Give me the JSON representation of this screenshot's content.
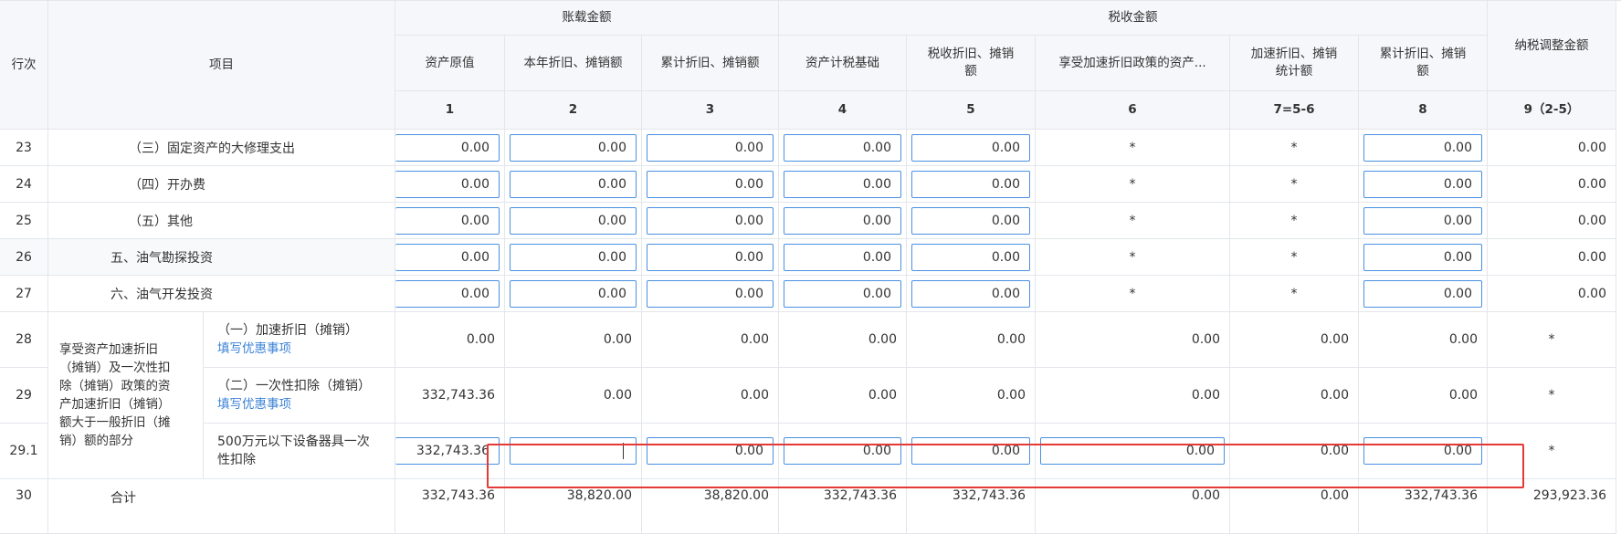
{
  "header": {
    "row_no": "行次",
    "item": "项目",
    "group_book": "账载金额",
    "group_tax": "税收金额",
    "adjust": "纳税调整金额",
    "cols": [
      "资产原值",
      "本年折旧、摊销额",
      "累计折旧、摊销额",
      "资产计税基础",
      "税收折旧、摊销额",
      "享受加速折旧政策的资产...",
      "加速折旧、摊销统计额",
      "累计折旧、摊销额"
    ],
    "nums": [
      "1",
      "2",
      "3",
      "4",
      "5",
      "6",
      "7=5-6",
      "8",
      "9（2-5）"
    ]
  },
  "rows": [
    {
      "no": "23",
      "label": "（三）固定资产的大修理支出",
      "v": [
        "0.00",
        "0.00",
        "0.00",
        "0.00",
        "0.00",
        "*",
        "*",
        "0.00",
        "0.00"
      ]
    },
    {
      "no": "24",
      "label": "（四）开办费",
      "v": [
        "0.00",
        "0.00",
        "0.00",
        "0.00",
        "0.00",
        "*",
        "*",
        "0.00",
        "0.00"
      ]
    },
    {
      "no": "25",
      "label": "（五）其他",
      "v": [
        "0.00",
        "0.00",
        "0.00",
        "0.00",
        "0.00",
        "*",
        "*",
        "0.00",
        "0.00"
      ]
    },
    {
      "no": "26",
      "label": "五、油气勘探投资",
      "v": [
        "0.00",
        "0.00",
        "0.00",
        "0.00",
        "0.00",
        "*",
        "*",
        "0.00",
        "0.00"
      ]
    },
    {
      "no": "27",
      "label": "六、油气开发投资",
      "v": [
        "0.00",
        "0.00",
        "0.00",
        "0.00",
        "0.00",
        "*",
        "*",
        "0.00",
        "0.00"
      ]
    }
  ],
  "group": {
    "label": "享受资产加速折旧（摊销）及一次性扣除（摊销）政策的资产加速折旧（摊销）额大于一般折旧（摊销）额的部分",
    "label_lines": [
      "享受资产加速折旧",
      "（摊销）及一次性扣",
      "除（摊销）政策的资",
      "产加速折旧（摊销）",
      "额大于一般折旧（摊",
      "销）额的部分"
    ],
    "rows": [
      {
        "no": "28",
        "label": "（一）加速折旧（摊销）",
        "link": "填写优惠事项",
        "v": [
          "0.00",
          "0.00",
          "0.00",
          "0.00",
          "0.00",
          "0.00",
          "0.00",
          "0.00",
          "*"
        ]
      },
      {
        "no": "29",
        "label": "（二）一次性扣除（摊销）",
        "link": "填写优惠事项",
        "v": [
          "332,743.36",
          "0.00",
          "0.00",
          "0.00",
          "0.00",
          "0.00",
          "0.00",
          "0.00",
          "*"
        ]
      },
      {
        "no": "29.1",
        "label_lines": [
          "500万元以下设备器具一次",
          "性扣除"
        ],
        "v": [
          "332,743.36",
          "",
          "0.00",
          "0.00",
          "0.00",
          "0.00",
          "0.00",
          "0.00",
          "*"
        ]
      }
    ]
  },
  "total": {
    "no": "30",
    "label": "合计",
    "v": [
      "332,743.36",
      "38,820.00",
      "38,820.00",
      "332,743.36",
      "332,743.36",
      "0.00",
      "0.00",
      "332,743.36",
      "293,923.36"
    ]
  }
}
